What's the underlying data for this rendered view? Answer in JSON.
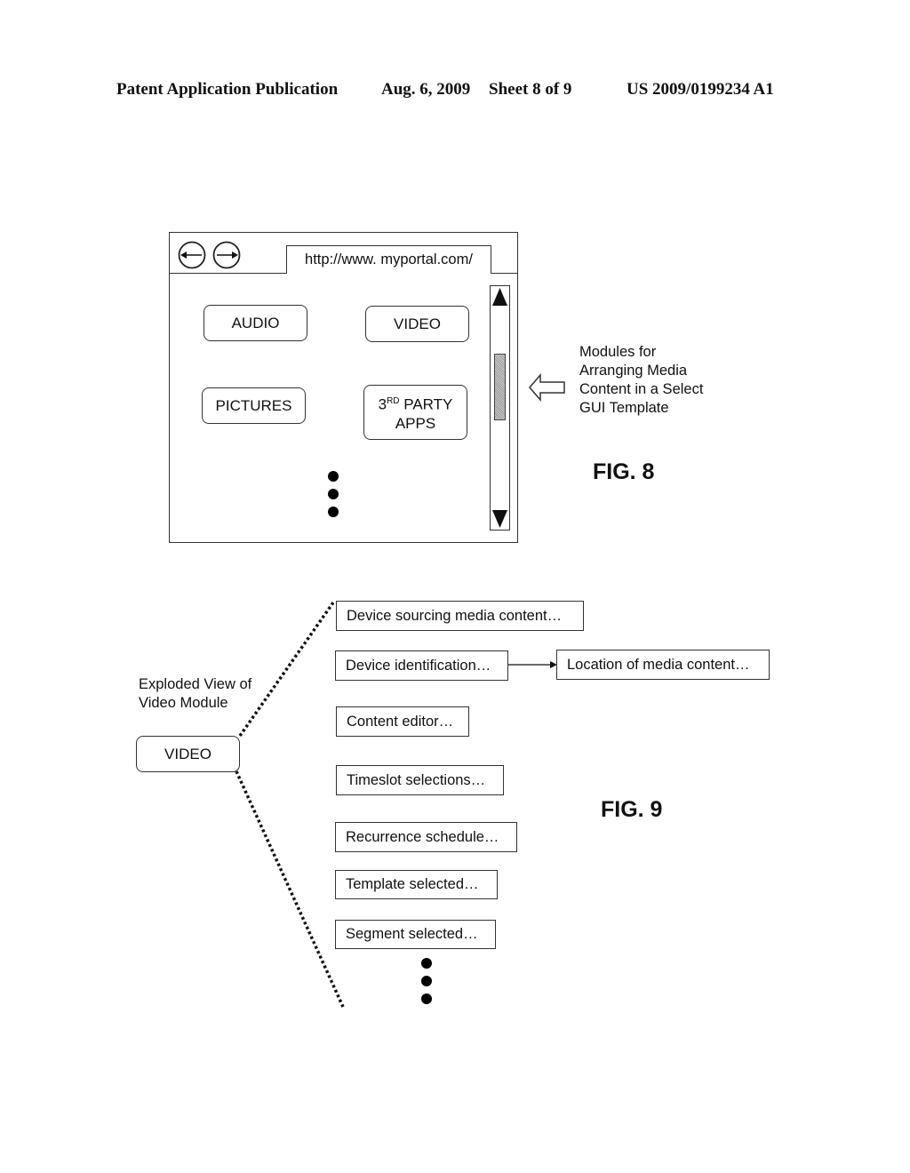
{
  "header": {
    "publication": "Patent Application Publication",
    "date": "Aug. 6, 2009",
    "sheet": "Sheet 8 of 9",
    "patent_number": "US 2009/0199234 A1"
  },
  "fig8": {
    "label": "FIG. 8",
    "browser": {
      "url": "http://www. myportal.com/",
      "back_icon": "back-arrow-icon",
      "forward_icon": "forward-arrow-icon"
    },
    "modules": {
      "audio": "AUDIO",
      "video": "VIDEO",
      "pictures": "PICTURES",
      "third_party_num": "3",
      "third_party_sup": "RD",
      "third_party_rest": " PARTY",
      "third_party_line2": "APPS"
    },
    "annotation": [
      "Modules for",
      "Arranging Media",
      "Content in a Select",
      "GUI Template"
    ]
  },
  "fig9": {
    "label": "FIG. 9",
    "caption": [
      "Exploded View of",
      "Video Module"
    ],
    "video_button": "VIDEO",
    "items": [
      "Device sourcing media content…",
      "Device identification…",
      "Content editor…",
      "Timeslot selections…",
      "Recurrence schedule…",
      "Template selected…",
      "Segment selected…"
    ],
    "linked_item": "Location of media content…"
  }
}
